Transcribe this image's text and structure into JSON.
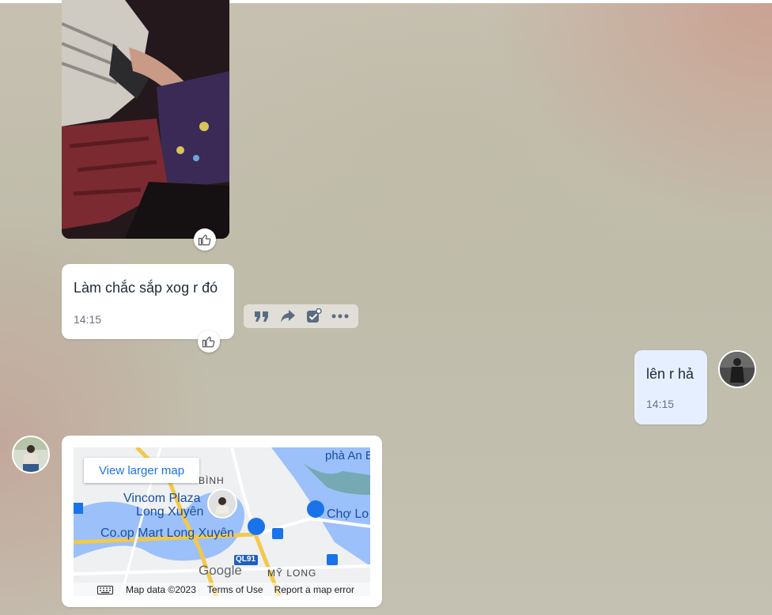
{
  "messages": {
    "received_text": {
      "text": "Làm chắc sắp xog r đó",
      "time": "14:15"
    },
    "sent_text": {
      "text": "lên r hả",
      "time": "14:15"
    }
  },
  "map": {
    "view_larger_label": "View larger map",
    "labels": {
      "pha_an": "phà An B",
      "binh": "BÌNH",
      "vincom": "Vincom Plaza",
      "long_xuyen": "Long Xuyên",
      "cho_lo": "Chợ Lo",
      "coop": "Co.op Mart Long Xuyên",
      "ql91": "QL91",
      "my_long": "MỸ LONG",
      "google": "Google"
    },
    "footer": {
      "map_data": "Map data ©2023",
      "terms": "Terms of Use",
      "report": "Report a map error"
    }
  },
  "icons": {
    "reaction": "thumbs-up-icon",
    "quote": "quote-icon",
    "forward": "forward-icon",
    "task": "task-check-icon",
    "more": "more-icon",
    "keyboard": "keyboard-icon"
  },
  "colors": {
    "sent_bubble": "#e5efff",
    "action_icon": "#5b6b84",
    "map_link": "#1a73e8"
  }
}
